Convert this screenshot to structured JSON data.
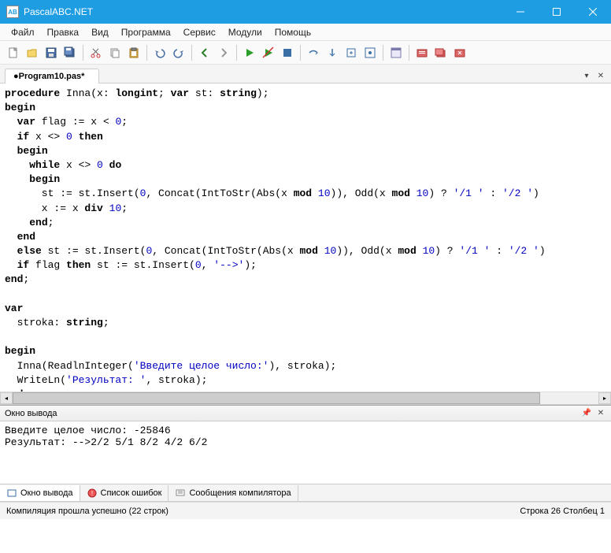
{
  "app": {
    "title": "PascalABC.NET"
  },
  "menu": {
    "items": [
      "Файл",
      "Правка",
      "Вид",
      "Программа",
      "Сервис",
      "Модули",
      "Помощь"
    ]
  },
  "tab": {
    "name": "●Program10.pas*"
  },
  "code": {
    "lines": [
      [
        {
          "c": "kw",
          "t": "procedure"
        },
        {
          "t": " Inna(x: "
        },
        {
          "c": "kw",
          "t": "longint"
        },
        {
          "t": "; "
        },
        {
          "c": "kw",
          "t": "var"
        },
        {
          "t": " st: "
        },
        {
          "c": "kw",
          "t": "string"
        },
        {
          "t": ");"
        }
      ],
      [
        {
          "c": "kw",
          "t": "begin"
        }
      ],
      [
        {
          "t": "  "
        },
        {
          "c": "kw",
          "t": "var"
        },
        {
          "t": " flag := x < "
        },
        {
          "c": "num",
          "t": "0"
        },
        {
          "t": ";"
        }
      ],
      [
        {
          "t": "  "
        },
        {
          "c": "kw",
          "t": "if"
        },
        {
          "t": " x <> "
        },
        {
          "c": "num",
          "t": "0"
        },
        {
          "t": " "
        },
        {
          "c": "kw",
          "t": "then"
        }
      ],
      [
        {
          "t": "  "
        },
        {
          "c": "kw",
          "t": "begin"
        }
      ],
      [
        {
          "t": "    "
        },
        {
          "c": "kw",
          "t": "while"
        },
        {
          "t": " x <> "
        },
        {
          "c": "num",
          "t": "0"
        },
        {
          "t": " "
        },
        {
          "c": "kw",
          "t": "do"
        }
      ],
      [
        {
          "t": "    "
        },
        {
          "c": "kw",
          "t": "begin"
        }
      ],
      [
        {
          "t": "      st := st.Insert("
        },
        {
          "c": "num",
          "t": "0"
        },
        {
          "t": ", Concat(IntToStr(Abs(x "
        },
        {
          "c": "kw",
          "t": "mod"
        },
        {
          "t": " "
        },
        {
          "c": "num",
          "t": "10"
        },
        {
          "t": ")), Odd(x "
        },
        {
          "c": "kw",
          "t": "mod"
        },
        {
          "t": " "
        },
        {
          "c": "num",
          "t": "10"
        },
        {
          "t": ") ? "
        },
        {
          "c": "str",
          "t": "'/1 '"
        },
        {
          "t": " : "
        },
        {
          "c": "str",
          "t": "'/2 '"
        },
        {
          "t": ")"
        }
      ],
      [
        {
          "t": "      x := x "
        },
        {
          "c": "kw",
          "t": "div"
        },
        {
          "t": " "
        },
        {
          "c": "num",
          "t": "10"
        },
        {
          "t": ";"
        }
      ],
      [
        {
          "t": "    "
        },
        {
          "c": "kw",
          "t": "end"
        },
        {
          "t": ";"
        }
      ],
      [
        {
          "t": "  "
        },
        {
          "c": "kw",
          "t": "end"
        }
      ],
      [
        {
          "t": "  "
        },
        {
          "c": "kw",
          "t": "else"
        },
        {
          "t": " st := st.Insert("
        },
        {
          "c": "num",
          "t": "0"
        },
        {
          "t": ", Concat(IntToStr(Abs(x "
        },
        {
          "c": "kw",
          "t": "mod"
        },
        {
          "t": " "
        },
        {
          "c": "num",
          "t": "10"
        },
        {
          "t": ")), Odd(x "
        },
        {
          "c": "kw",
          "t": "mod"
        },
        {
          "t": " "
        },
        {
          "c": "num",
          "t": "10"
        },
        {
          "t": ") ? "
        },
        {
          "c": "str",
          "t": "'/1 '"
        },
        {
          "t": " : "
        },
        {
          "c": "str",
          "t": "'/2 '"
        },
        {
          "t": ")"
        }
      ],
      [
        {
          "t": "  "
        },
        {
          "c": "kw",
          "t": "if"
        },
        {
          "t": " flag "
        },
        {
          "c": "kw",
          "t": "then"
        },
        {
          "t": " st := st.Insert("
        },
        {
          "c": "num",
          "t": "0"
        },
        {
          "t": ", "
        },
        {
          "c": "str",
          "t": "'-->'"
        },
        {
          "t": ");"
        }
      ],
      [
        {
          "c": "kw",
          "t": "end"
        },
        {
          "t": ";"
        }
      ],
      [
        {
          "t": ""
        }
      ],
      [
        {
          "c": "kw",
          "t": "var"
        }
      ],
      [
        {
          "t": "  stroka: "
        },
        {
          "c": "kw",
          "t": "string"
        },
        {
          "t": ";"
        }
      ],
      [
        {
          "t": ""
        }
      ],
      [
        {
          "c": "kw",
          "t": "begin"
        }
      ],
      [
        {
          "t": "  Inna(ReadlnInteger("
        },
        {
          "c": "str",
          "t": "'Введите целое число:'"
        },
        {
          "t": "), stroka);"
        }
      ],
      [
        {
          "t": "  WriteLn("
        },
        {
          "c": "str",
          "t": "'Результат: '"
        },
        {
          "t": ", stroka);"
        }
      ],
      [
        {
          "c": "kw",
          "t": "end"
        },
        {
          "t": "."
        }
      ]
    ]
  },
  "output": {
    "title": "Окно вывода",
    "text": "Введите целое число: -25846\nРезультат: -->2/2 5/1 8/2 4/2 6/2"
  },
  "bottomTabs": {
    "items": [
      "Окно вывода",
      "Список ошибок",
      "Сообщения компилятора"
    ]
  },
  "status": {
    "left": "Компиляция прошла успешно (22 строк)",
    "right": "Строка  26  Столбец  1"
  }
}
